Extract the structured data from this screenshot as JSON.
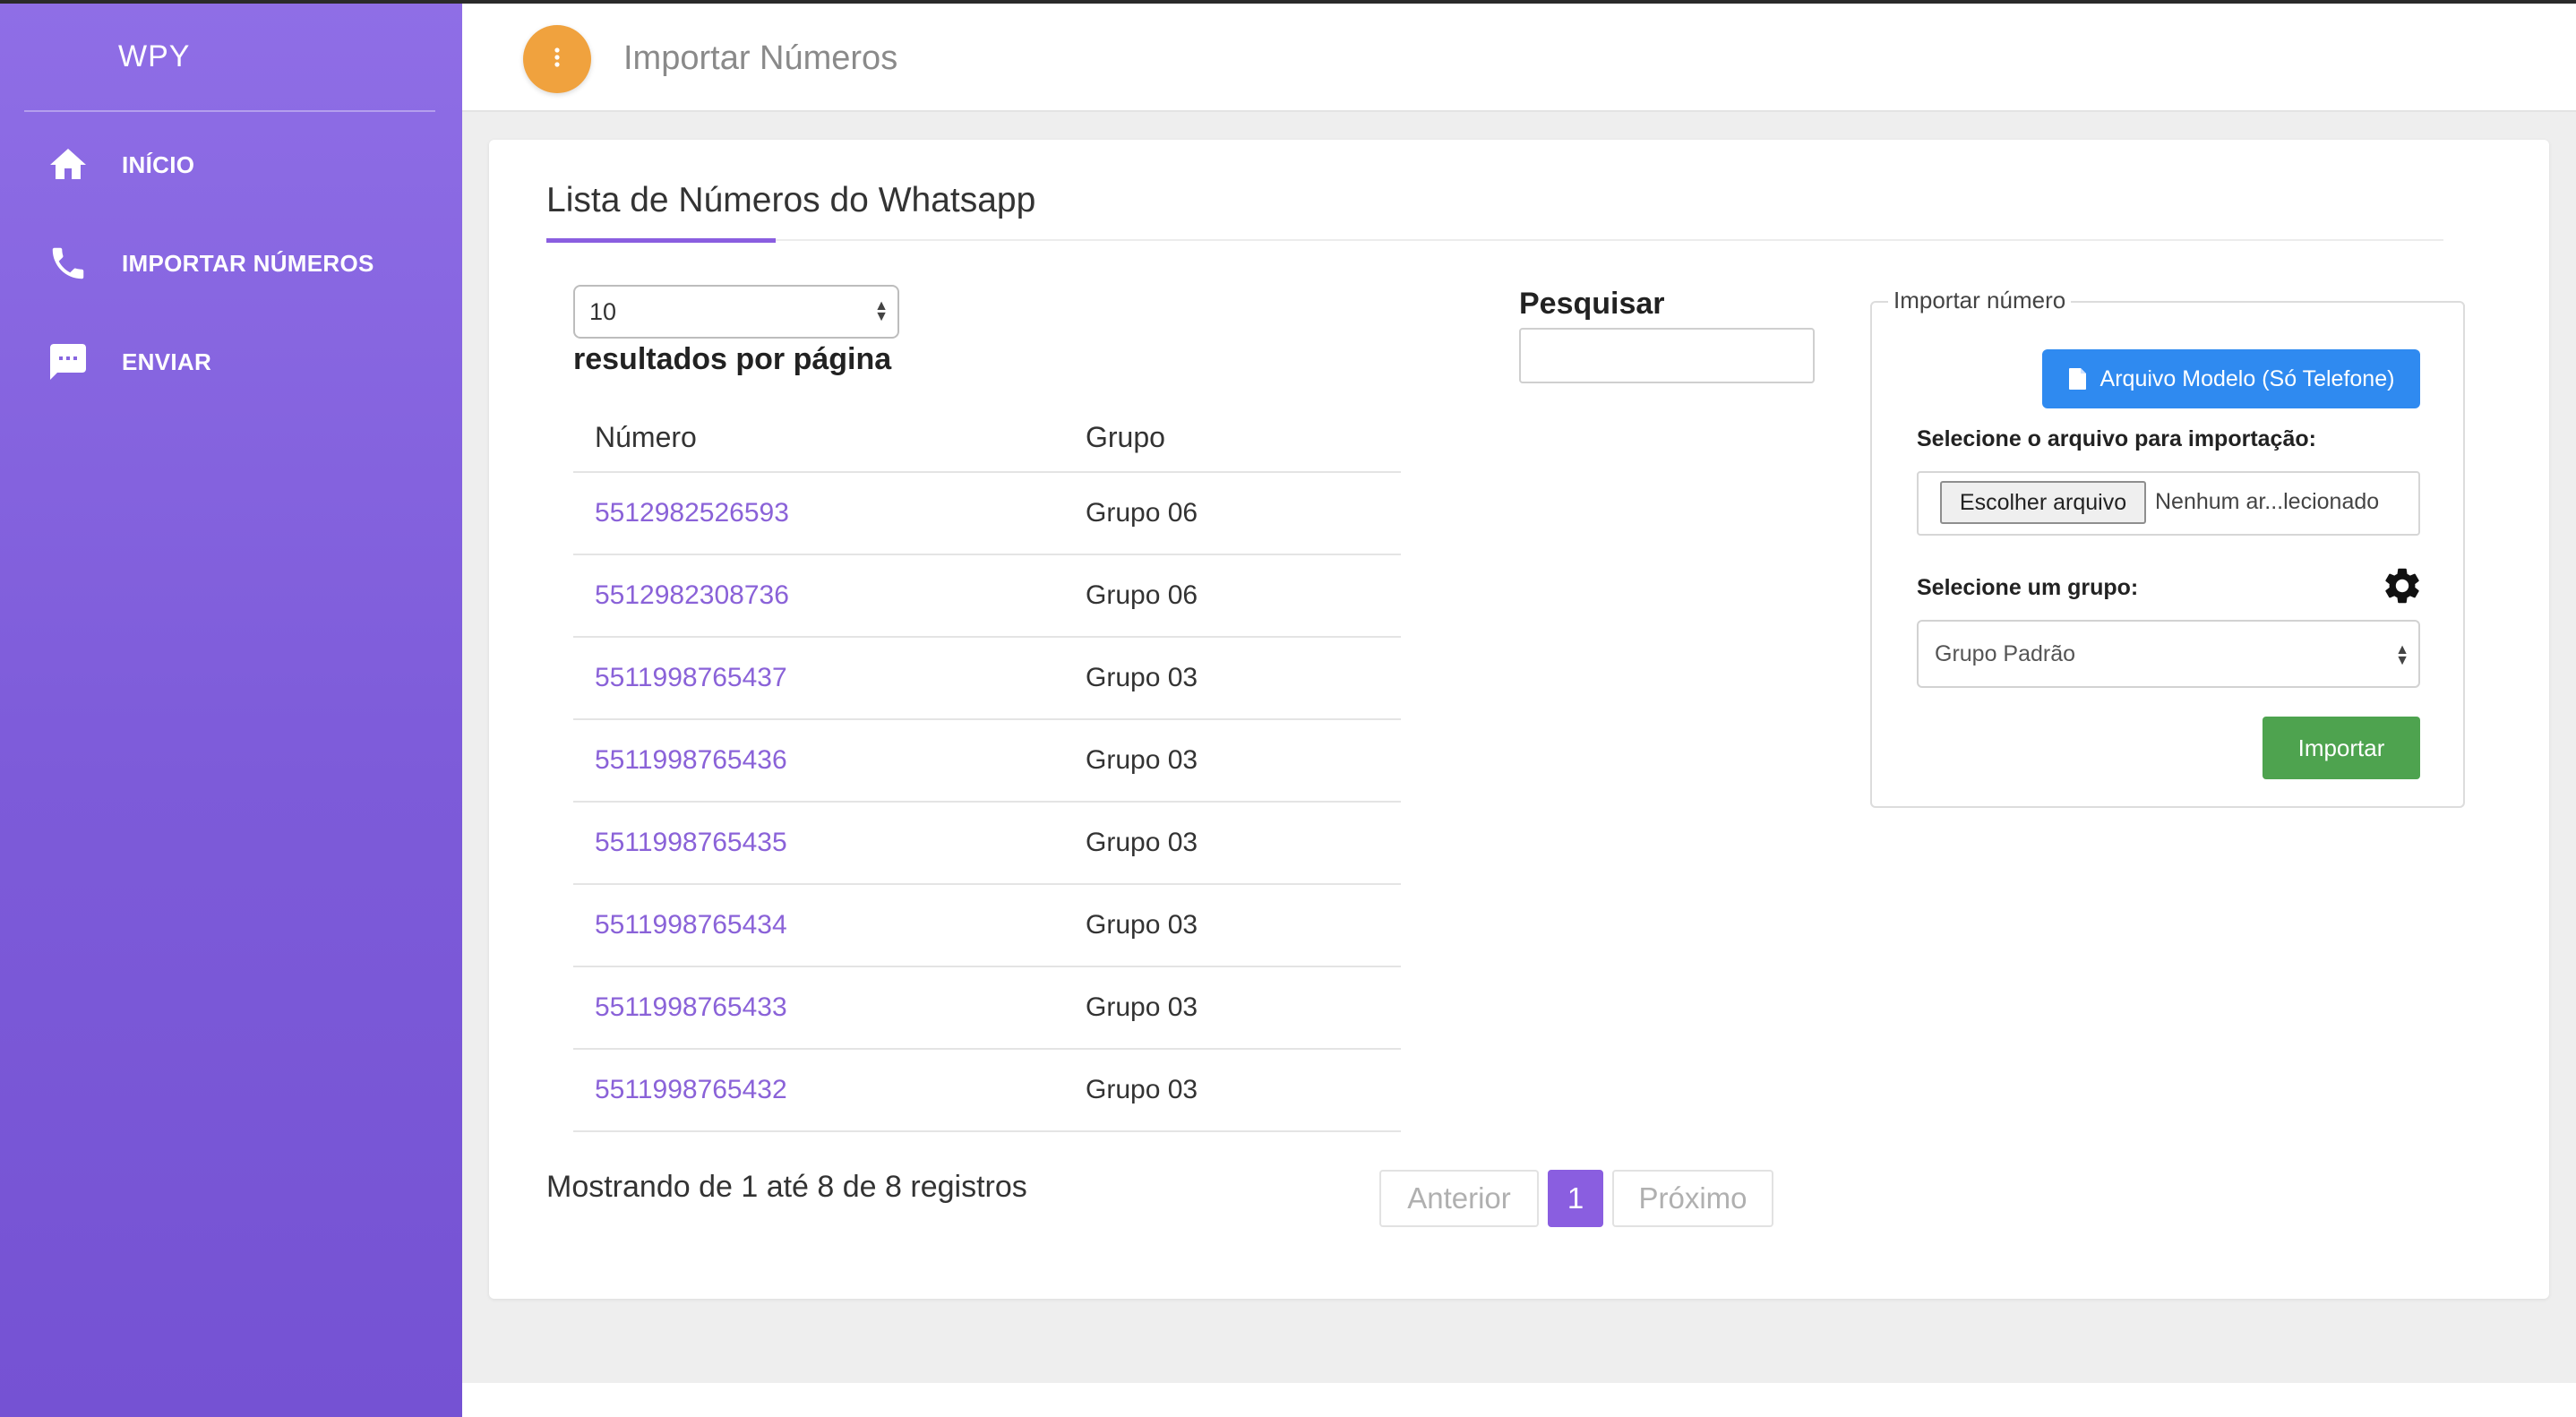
{
  "brand": "WPY",
  "sidebar": {
    "items": [
      {
        "label": "INÍCIO",
        "icon": "home-icon"
      },
      {
        "label": "IMPORTAR NÚMEROS",
        "icon": "phone-icon"
      },
      {
        "label": "ENVIAR",
        "icon": "chat-icon"
      }
    ]
  },
  "header": {
    "title": "Importar Números",
    "menu_icon": "more-vertical-icon"
  },
  "card": {
    "title": "Lista de Números do Whatsapp"
  },
  "table_controls": {
    "page_length_value": "10",
    "page_length_label": "resultados por página",
    "search_label": "Pesquisar",
    "search_value": ""
  },
  "table": {
    "columns": [
      "Número",
      "Grupo"
    ],
    "rows": [
      {
        "numero": "5512982526593",
        "grupo": "Grupo 06"
      },
      {
        "numero": "5512982308736",
        "grupo": "Grupo 06"
      },
      {
        "numero": "5511998765437",
        "grupo": "Grupo 03"
      },
      {
        "numero": "5511998765436",
        "grupo": "Grupo 03"
      },
      {
        "numero": "5511998765435",
        "grupo": "Grupo 03"
      },
      {
        "numero": "5511998765434",
        "grupo": "Grupo 03"
      },
      {
        "numero": "5511998765433",
        "grupo": "Grupo 03"
      },
      {
        "numero": "5511998765432",
        "grupo": "Grupo 03"
      }
    ],
    "info": "Mostrando de 1 até 8 de 8 registros"
  },
  "pagination": {
    "previous": "Anterior",
    "current": "1",
    "next": "Próximo"
  },
  "import_panel": {
    "legend": "Importar número",
    "model_button": "Arquivo Modelo (Só Telefone)",
    "file_label": "Selecione o arquivo para importação:",
    "file_button": "Escolher arquivo",
    "file_status": "Nenhum ar...lecionado",
    "group_label": "Selecione um grupo:",
    "group_value": "Grupo Padrão",
    "import_button": "Importar"
  },
  "colors": {
    "sidebar": "#8560dd",
    "accent": "#8a5ee0",
    "header_button": "#f0a23e",
    "model_button": "#2f8af0",
    "import_button": "#4ea34f"
  }
}
